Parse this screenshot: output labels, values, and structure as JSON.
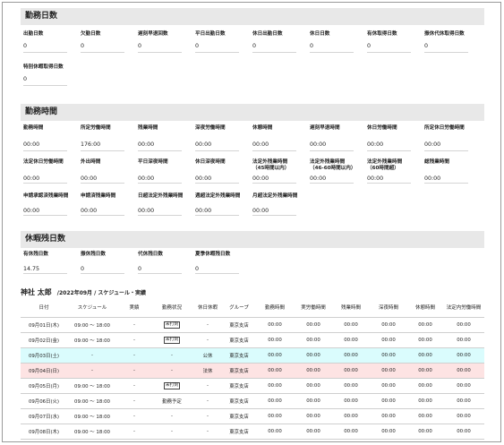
{
  "attendance_days": {
    "title": "勤務日数",
    "row1": [
      {
        "label": "出勤日数",
        "value": "0"
      },
      {
        "label": "欠勤日数",
        "value": "0"
      },
      {
        "label": "遅刻早退回数",
        "value": "0"
      },
      {
        "label": "平日出勤日数",
        "value": "0"
      },
      {
        "label": "休日出勤日数",
        "value": "0"
      },
      {
        "label": "休日日数",
        "value": "0"
      },
      {
        "label": "有休取得日数",
        "value": "0"
      },
      {
        "label": "振休代休取得日数",
        "value": "0"
      }
    ],
    "row2": [
      {
        "label": "特別休暇取得日数",
        "value": "0"
      }
    ]
  },
  "work_hours": {
    "title": "勤務時間",
    "row1": [
      {
        "label": "勤務時間",
        "value": "00:00"
      },
      {
        "label": "所定労働時間",
        "value": "176:00"
      },
      {
        "label": "残業時間",
        "value": "00:00"
      },
      {
        "label": "深夜労働時間",
        "value": "00:00"
      },
      {
        "label": "休憩時間",
        "value": "00:00"
      },
      {
        "label": "遅刻早退時間",
        "value": "00:00"
      },
      {
        "label": "休日労働時間",
        "value": "00:00"
      },
      {
        "label": "所定休日労働時間",
        "value": "00:00"
      }
    ],
    "row2": [
      {
        "label": "法定休日労働時間",
        "value": "00:00"
      },
      {
        "label": "外出時間",
        "value": "00:00"
      },
      {
        "label": "平日深夜時間",
        "value": "00:00"
      },
      {
        "label": "休日深夜時間",
        "value": "00:00"
      },
      {
        "label": "法定外残業時間\n（45時間以内）",
        "value": "00:00"
      },
      {
        "label": "法定外残業時間\n（46-60時間以内）",
        "value": "00:00"
      },
      {
        "label": "法定外残業時間\n（60時間超）",
        "value": "00:00"
      },
      {
        "label": "総残業時間",
        "value": "00:00"
      }
    ],
    "row3": [
      {
        "label": "申請承認済残業時間",
        "value": "00:00"
      },
      {
        "label": "申請済残業時間",
        "value": "00:00"
      },
      {
        "label": "日超法定外残業時間",
        "value": "00:00"
      },
      {
        "label": "週超法定外残業時間",
        "value": "00:00"
      },
      {
        "label": "月超法定外残業時間",
        "value": "00:00"
      }
    ]
  },
  "leave_balance": {
    "title": "休暇残日数",
    "row1": [
      {
        "label": "有休残日数",
        "value": "14.75"
      },
      {
        "label": "振休残日数",
        "value": "0"
      },
      {
        "label": "代休残日数",
        "value": "0"
      },
      {
        "label": "夏季休暇残日数",
        "value": "0"
      }
    ]
  },
  "schedule": {
    "name": "神社 太郎",
    "subtitle": "/2022年09月 / スケジュール・実績",
    "headers": [
      "日付",
      "スケジュール",
      "実績",
      "勤務状況",
      "休日休暇",
      "グループ",
      "勤務時間",
      "実労働時間",
      "残業時間",
      "深夜時間",
      "休憩時間",
      "法定内労働時間"
    ],
    "rows": [
      {
        "date": "09月01日(木)",
        "schedule": "09:00 ～ 18:00",
        "actual": "-",
        "status": "未打刻",
        "status_stamp": true,
        "holiday": "-",
        "group": "東京支店",
        "work": "00:00",
        "real": "00:00",
        "overtime": "00:00",
        "night": "00:00",
        "break": "00:00",
        "legal": "00:00",
        "type": "normal"
      },
      {
        "date": "09月02日(金)",
        "schedule": "09:00 ～ 18:00",
        "actual": "-",
        "status": "未打刻",
        "status_stamp": true,
        "holiday": "-",
        "group": "東京支店",
        "work": "00:00",
        "real": "00:00",
        "overtime": "00:00",
        "night": "00:00",
        "break": "00:00",
        "legal": "00:00",
        "type": "normal"
      },
      {
        "date": "09月03日(土)",
        "schedule": "-",
        "actual": "-",
        "status": "-",
        "status_stamp": false,
        "holiday": "公休",
        "group": "東京支店",
        "work": "00:00",
        "real": "00:00",
        "overtime": "00:00",
        "night": "00:00",
        "break": "00:00",
        "legal": "00:00",
        "type": "sat"
      },
      {
        "date": "09月04日(日)",
        "schedule": "-",
        "actual": "-",
        "status": "-",
        "status_stamp": false,
        "holiday": "法休",
        "group": "東京支店",
        "work": "00:00",
        "real": "00:00",
        "overtime": "00:00",
        "night": "00:00",
        "break": "00:00",
        "legal": "00:00",
        "type": "sun"
      },
      {
        "date": "09月05日(月)",
        "schedule": "09:00 ～ 18:00",
        "actual": "-",
        "status": "未打刻",
        "status_stamp": true,
        "holiday": "-",
        "group": "東京支店",
        "work": "00:00",
        "real": "00:00",
        "overtime": "00:00",
        "night": "00:00",
        "break": "00:00",
        "legal": "00:00",
        "type": "normal"
      },
      {
        "date": "09月06日(火)",
        "schedule": "09:00 ～ 18:00",
        "actual": "-",
        "status": "勤務予定",
        "status_stamp": false,
        "holiday": "-",
        "group": "東京支店",
        "work": "00:00",
        "real": "00:00",
        "overtime": "00:00",
        "night": "00:00",
        "break": "00:00",
        "legal": "00:00",
        "type": "normal"
      },
      {
        "date": "09月07日(水)",
        "schedule": "09:00 ～ 18:00",
        "actual": "-",
        "status": "-",
        "status_stamp": false,
        "holiday": "-",
        "group": "東京支店",
        "work": "00:00",
        "real": "00:00",
        "overtime": "00:00",
        "night": "00:00",
        "break": "00:00",
        "legal": "00:00",
        "type": "normal"
      },
      {
        "date": "09月08日(木)",
        "schedule": "09:00 ～ 18:00",
        "actual": "-",
        "status": "-",
        "status_stamp": false,
        "holiday": "-",
        "group": "東京支店",
        "work": "00:00",
        "real": "00:00",
        "overtime": "00:00",
        "night": "00:00",
        "break": "00:00",
        "legal": "00:00",
        "type": "normal"
      }
    ]
  }
}
